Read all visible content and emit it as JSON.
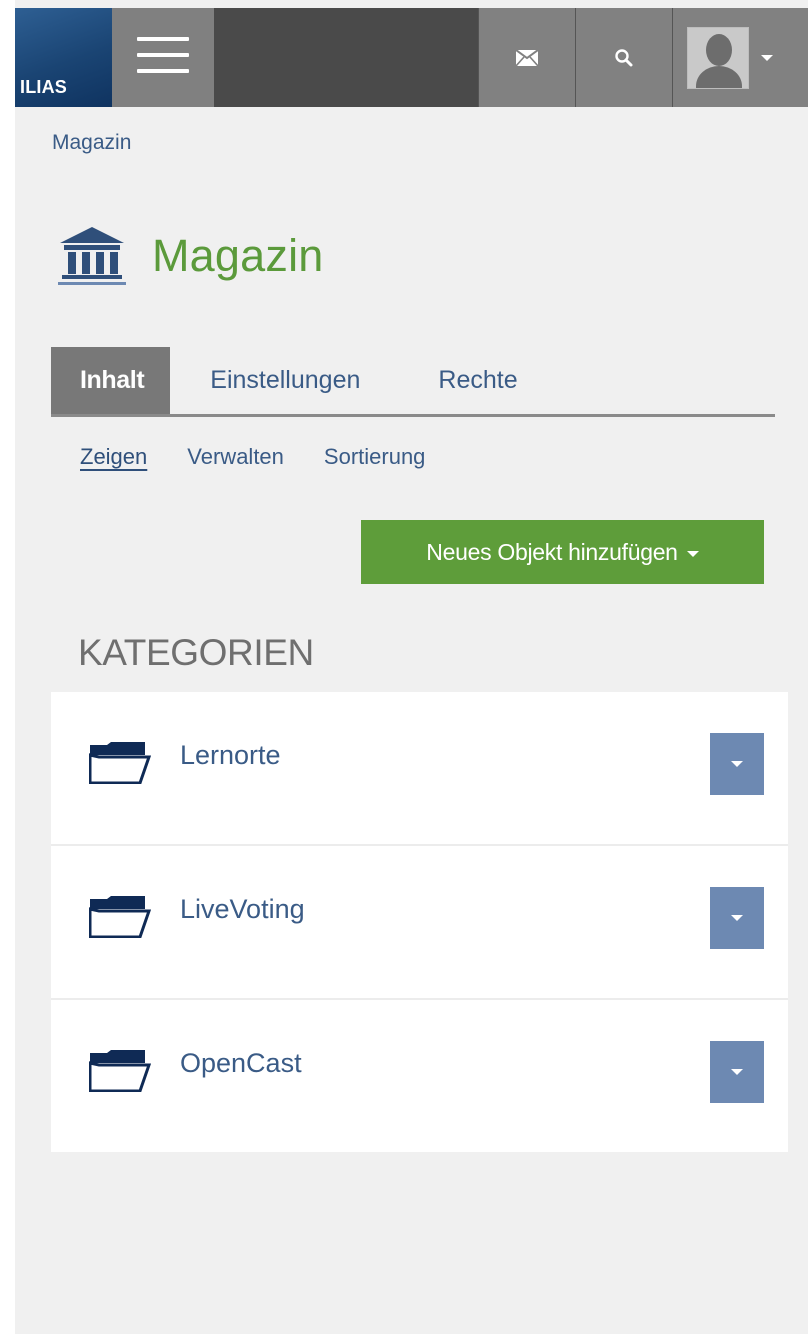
{
  "header": {
    "logo_text": "ILIAS",
    "menu_icon": "hamburger-icon",
    "mail_icon": "mail-icon",
    "search_icon": "search-icon",
    "user_icon": "user-avatar-icon"
  },
  "breadcrumb": "Magazin",
  "page": {
    "title": "Magazin",
    "icon": "bank-icon",
    "title_color": "#5b9a3b"
  },
  "tabs": [
    {
      "label": "Inhalt",
      "active": true
    },
    {
      "label": "Einstellungen",
      "active": false
    },
    {
      "label": "Rechte",
      "active": false
    }
  ],
  "subtabs": [
    {
      "label": "Zeigen",
      "active": true
    },
    {
      "label": "Verwalten",
      "active": false
    },
    {
      "label": "Sortierung",
      "active": false
    }
  ],
  "add_button": {
    "label": "Neues Objekt hinzufügen",
    "color": "#5e9d3a"
  },
  "section_title": "KATEGORIEN",
  "categories": [
    {
      "title": "Lernorte",
      "icon": "folder-icon"
    },
    {
      "title": "LiveVoting",
      "icon": "folder-icon"
    },
    {
      "title": "OpenCast",
      "icon": "folder-icon"
    }
  ]
}
